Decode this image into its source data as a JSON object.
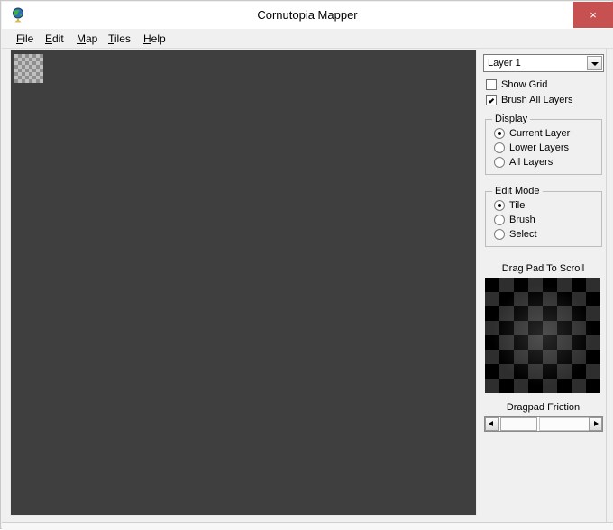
{
  "window": {
    "title": "Cornutopia Mapper",
    "icon": "globe-icon",
    "close_label": "×",
    "close_color": "#c75050"
  },
  "menubar": {
    "items": [
      {
        "mnemonic": "F",
        "rest": "ile",
        "label": "File"
      },
      {
        "mnemonic": "E",
        "rest": "dit",
        "label": "Edit"
      },
      {
        "mnemonic": "M",
        "rest": "ap",
        "label": "Map"
      },
      {
        "mnemonic": "T",
        "rest": "iles",
        "label": "Tiles"
      },
      {
        "mnemonic": "H",
        "rest": "elp",
        "label": "Help"
      }
    ]
  },
  "canvas": {
    "background_color": "#3f3f3f",
    "tile_description": "transparency-checker-tile"
  },
  "panel": {
    "layer_select": {
      "value": "Layer 1",
      "options": [
        "Layer 1"
      ]
    },
    "checkboxes": [
      {
        "label": "Show Grid",
        "checked": false
      },
      {
        "label": "Brush All Layers",
        "checked": true
      }
    ],
    "display_group": {
      "title": "Display",
      "options": [
        {
          "label": "Current Layer",
          "selected": true
        },
        {
          "label": "Lower Layers",
          "selected": false
        },
        {
          "label": "All Layers",
          "selected": false
        }
      ]
    },
    "edit_mode_group": {
      "title": "Edit Mode",
      "options": [
        {
          "label": "Tile",
          "selected": true
        },
        {
          "label": "Brush",
          "selected": false
        },
        {
          "label": "Select",
          "selected": false
        }
      ]
    },
    "dragpad": {
      "label": "Drag Pad To Scroll"
    },
    "friction": {
      "label": "Dragpad Friction",
      "left_arrow": "◄",
      "right_arrow": "►"
    }
  }
}
